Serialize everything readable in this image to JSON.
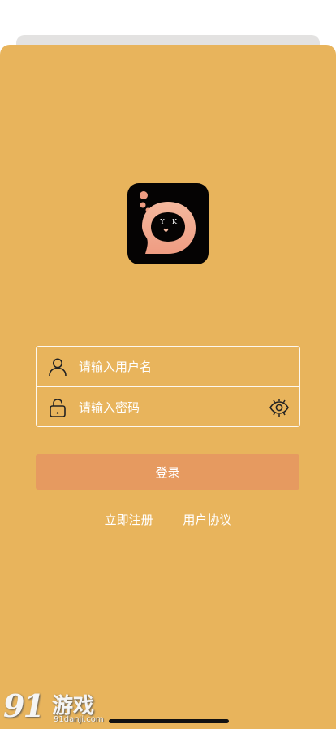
{
  "login": {
    "username_placeholder": "请输入用户名",
    "password_placeholder": "请输入密码",
    "submit_label": "登录",
    "register_link": "立即注册",
    "agreement_link": "用户协议"
  },
  "logo": {
    "text_left": "Y",
    "text_right": "K"
  },
  "watermark": {
    "number": "91",
    "text": "游戏",
    "url": "91danji.com"
  },
  "colors": {
    "background": "#e8b45c",
    "button": "#e69a60",
    "logo_bg": "#050303",
    "logo_accent": "#f2a98d"
  },
  "icons": {
    "username": "user-icon",
    "password": "lock-icon",
    "visibility": "eye-icon"
  }
}
